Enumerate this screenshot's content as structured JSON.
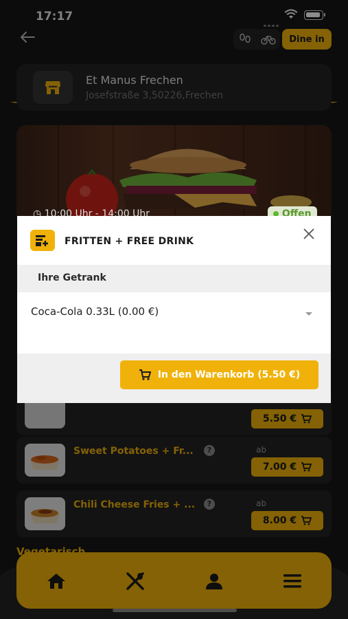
{
  "status_bar": {
    "time": "17:17"
  },
  "header": {
    "modes": [
      "walk-icon",
      "bike-icon"
    ],
    "active_mode": "Dine in"
  },
  "store": {
    "name": "Et Manus Frechen",
    "address": "Josefstraße 3,50226,Frechen"
  },
  "hero": {
    "hours": "10:00 Uhr - 14:00 Uhr",
    "status": "Offen"
  },
  "items": [
    {
      "name": "",
      "price": "5.50 €",
      "show_ab": false
    },
    {
      "name": "Sweet Potatoes + Fr...",
      "ab": "ab",
      "price": "7.00 €"
    },
    {
      "name": "Chili Cheese Fries + ...",
      "ab": "ab",
      "price": "8.00 €"
    }
  ],
  "section_title": "Vegetarisch",
  "modal": {
    "title": "FRITTEN + FREE DRINK",
    "section_label": "Ihre Getrank",
    "selected_option": "Coca-Cola 0.33L (0.00 €)",
    "cart_button": "In den Warenkorb (5.50 €)"
  },
  "bottom_nav": [
    "home-icon",
    "restaurant-icon",
    "profile-icon",
    "menu-icon"
  ],
  "colors": {
    "accent": "#f0b20a",
    "background": "#161616",
    "card": "#232323"
  }
}
